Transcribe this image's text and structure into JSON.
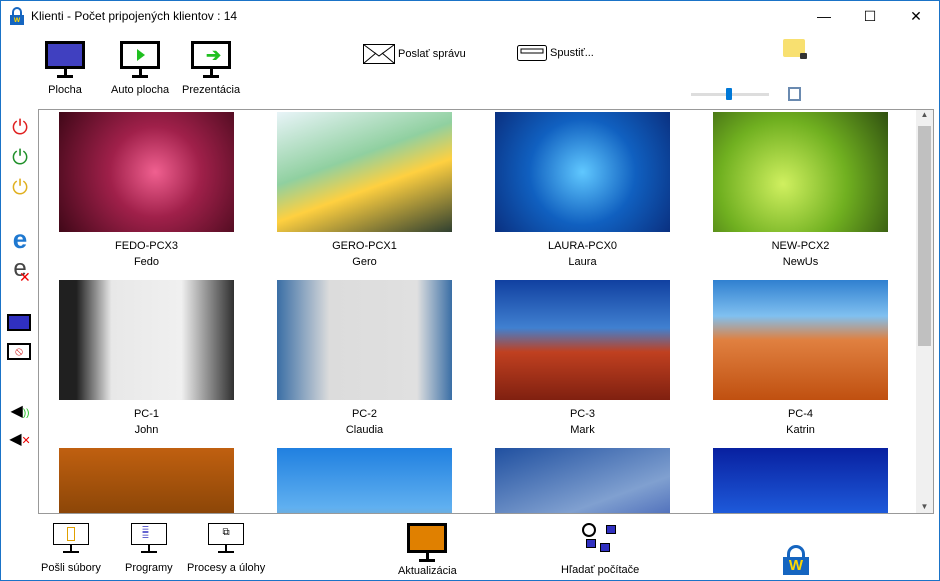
{
  "window": {
    "title": "Klienti  -  Počet pripojených klientov : 14",
    "minimize": "—",
    "maximize": "☐",
    "close": "✕"
  },
  "toolbar": {
    "plocha": "Plocha",
    "auto_plocha": "Auto plocha",
    "prezentacia": "Prezentácia",
    "poslat_spravu": "Poslať správu",
    "spustit": "Spustiť..."
  },
  "bottom": {
    "posli_subory": "Pošli súbory",
    "programy": "Programy",
    "procesy": "Procesy a úlohy",
    "aktualizacia": "Aktualizácia",
    "hladat": "Hľadať počítače"
  },
  "clients": [
    {
      "pc": "FEDO-PCX3",
      "user": "Fedo",
      "bg": "radial-gradient(circle at 55% 50%,#f06090,#a0204a 40%,#400818)"
    },
    {
      "pc": "GERO-PCX1",
      "user": "Gero",
      "bg": "linear-gradient(160deg,#e8f4f8,#90d0a0 40%,#ffd040 60%,#304030)"
    },
    {
      "pc": "LAURA-PCX0",
      "user": "Laura",
      "bg": "radial-gradient(circle at 50% 50%,#60c8ff,#1060c0 50%,#0a3080)"
    },
    {
      "pc": "NEW-PCX2",
      "user": "NewUs",
      "bg": "radial-gradient(circle at 40% 60%,#d0f060,#70b020 50%,#305010)"
    },
    {
      "pc": "PC-1",
      "user": "John",
      "bg": "linear-gradient(90deg,#202020 10%,#e8e8e8 30%,#f0f0f0 70%,#303030)"
    },
    {
      "pc": "PC-2",
      "user": "Claudia",
      "bg": "linear-gradient(90deg,#3a6ea5,#dcdcdc 30%,#e0e0e0 80%,#3a6ea5)"
    },
    {
      "pc": "PC-3",
      "user": "Mark",
      "bg": "linear-gradient(180deg,#1040a0,#4080d0 40%,#c04020 60%,#802010)"
    },
    {
      "pc": "PC-4",
      "user": "Katrin",
      "bg": "linear-gradient(180deg,#3080d0,#80c0f0 30%,#e08040 50%,#c05010)"
    },
    {
      "pc": "",
      "user": "",
      "bg": "linear-gradient(180deg,#c06010,#603000)"
    },
    {
      "pc": "",
      "user": "",
      "bg": "linear-gradient(180deg,#2080e0,#60b0f0 50%,#f09020)"
    },
    {
      "pc": "",
      "user": "",
      "bg": "linear-gradient(160deg,#2050a0,#80a0d0 50%,#1030a0)"
    },
    {
      "pc": "",
      "user": "",
      "bg": "linear-gradient(180deg,#0820a0,#2060e0 60%,#80c0ff)"
    }
  ]
}
